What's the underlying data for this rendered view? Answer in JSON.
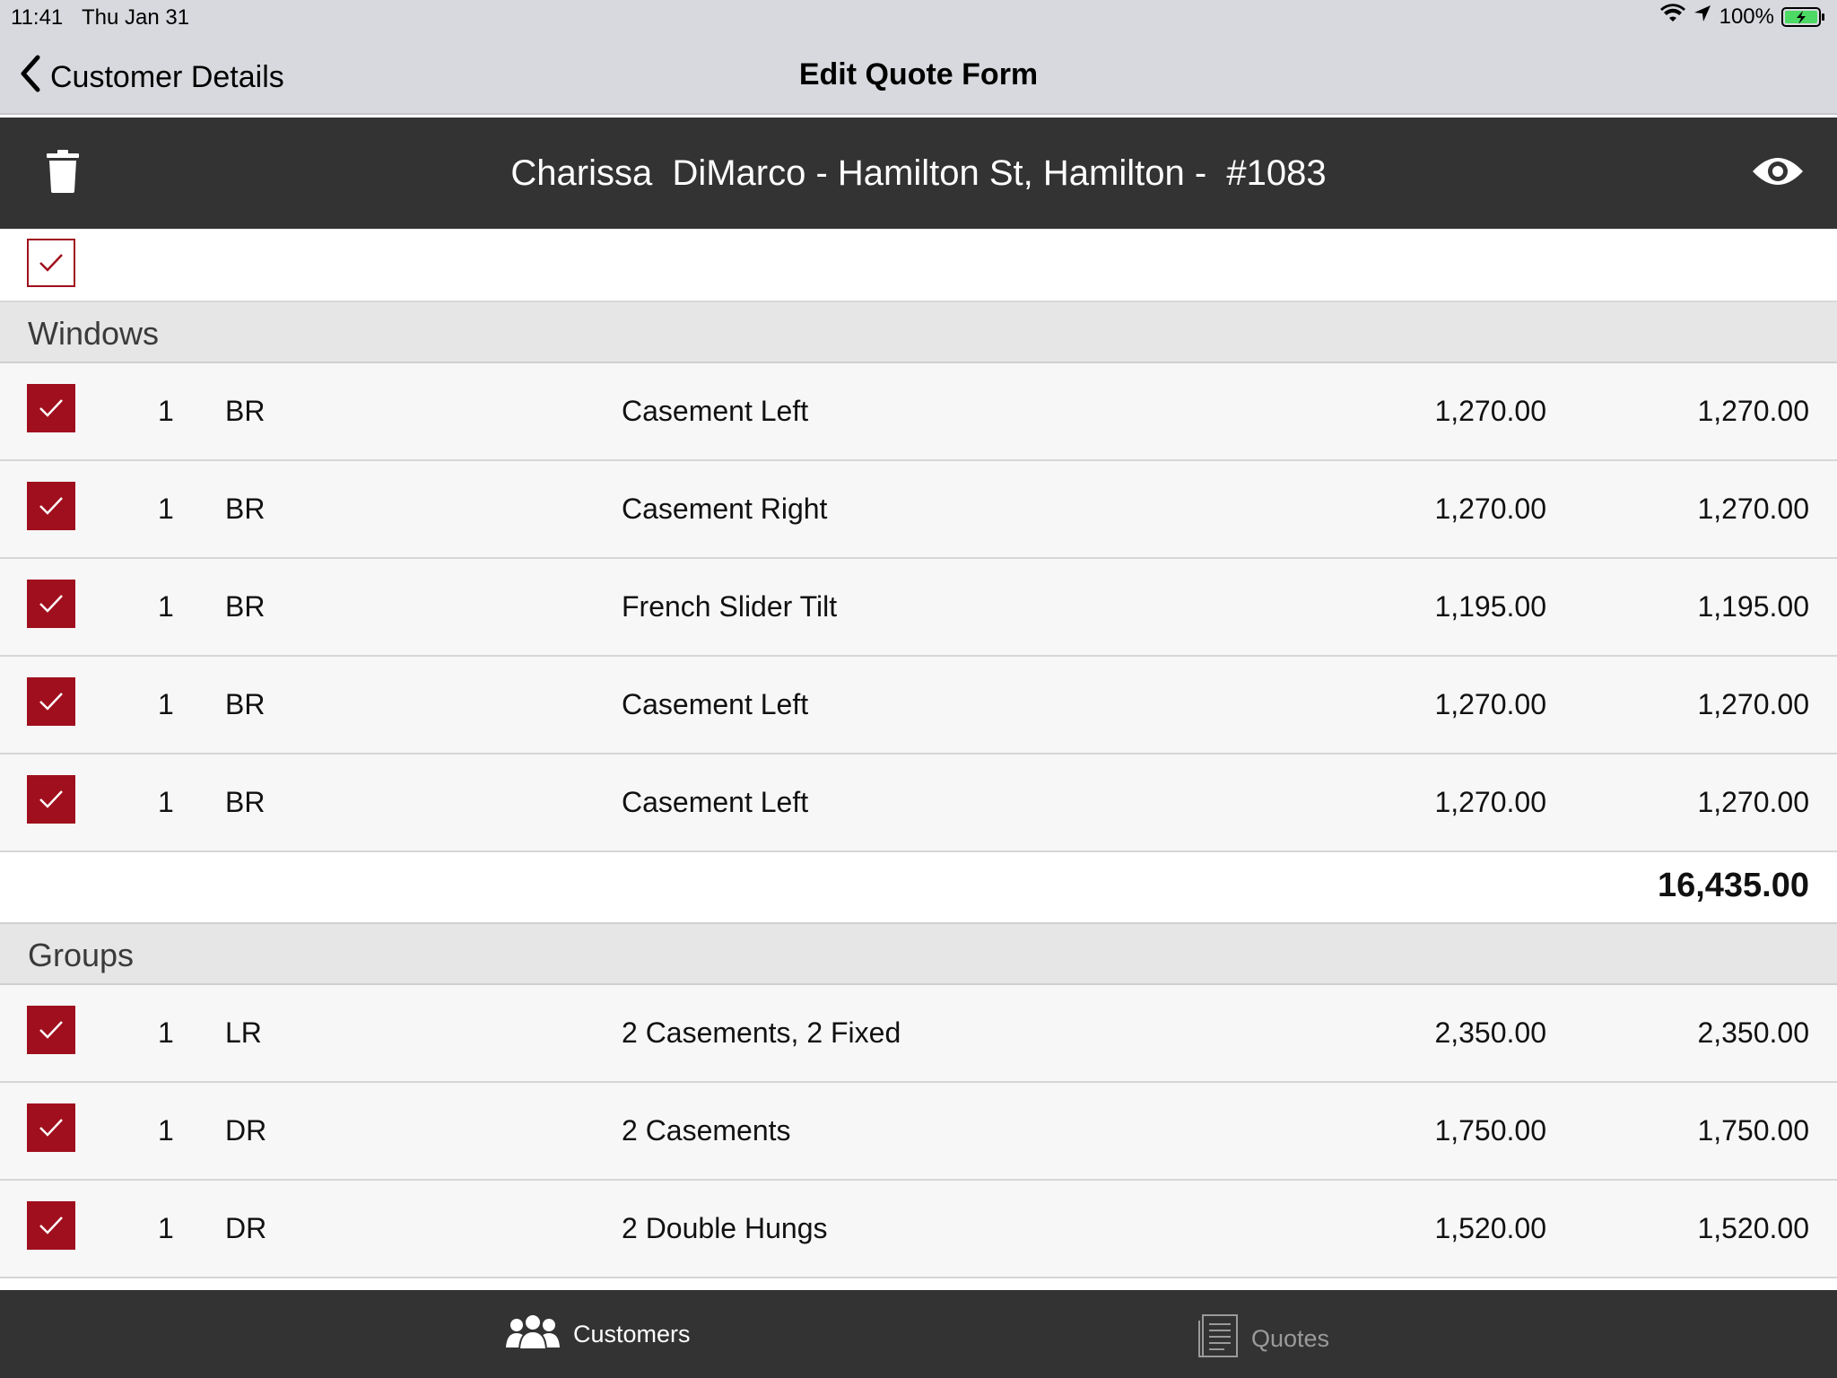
{
  "status_bar": {
    "time": "11:41",
    "date": "Thu Jan 31",
    "battery": "100%"
  },
  "nav": {
    "back_label": "Customer Details",
    "title": "Edit Quote Form"
  },
  "header": {
    "title": "Charissa  DiMarco - Hamilton St, Hamilton -  #1083"
  },
  "sections": {
    "windows": {
      "label": "Windows",
      "items": [
        {
          "checked": true,
          "qty": "1",
          "room": "BR",
          "description": "Casement Left",
          "price": "1,270.00",
          "total": "1,270.00"
        },
        {
          "checked": true,
          "qty": "1",
          "room": "BR",
          "description": "Casement Right",
          "price": "1,270.00",
          "total": "1,270.00"
        },
        {
          "checked": true,
          "qty": "1",
          "room": "BR",
          "description": "French Slider Tilt",
          "price": "1,195.00",
          "total": "1,195.00"
        },
        {
          "checked": true,
          "qty": "1",
          "room": "BR",
          "description": "Casement Left",
          "price": "1,270.00",
          "total": "1,270.00"
        },
        {
          "checked": true,
          "qty": "1",
          "room": "BR",
          "description": "Casement Left",
          "price": "1,270.00",
          "total": "1,270.00"
        }
      ],
      "subtotal": "16,435.00"
    },
    "groups": {
      "label": "Groups",
      "items": [
        {
          "checked": true,
          "qty": "1",
          "room": "LR",
          "description": "2 Casements, 2 Fixed",
          "price": "2,350.00",
          "total": "2,350.00"
        },
        {
          "checked": true,
          "qty": "1",
          "room": "DR",
          "description": "2 Casements",
          "price": "1,750.00",
          "total": "1,750.00"
        },
        {
          "checked": true,
          "qty": "1",
          "room": "DR",
          "description": "2 Double Hungs",
          "price": "1,520.00",
          "total": "1,520.00"
        }
      ]
    }
  },
  "tabs": {
    "customers": "Customers",
    "quotes": "Quotes"
  },
  "icons": {
    "back": "chevron-left-icon",
    "trash": "trash-icon",
    "eye": "eye-icon",
    "wifi": "wifi-icon",
    "location": "location-arrow-icon",
    "battery": "battery-charging-icon",
    "customers": "people-icon",
    "quotes": "document-icon",
    "check": "checkmark-icon"
  },
  "colors": {
    "accent": "#a00f1d",
    "header_bg": "#333333",
    "nav_bg": "#d7d9de",
    "section_bg": "#e6e6e6",
    "row_bg": "#f7f7f7",
    "battery_green": "#4cd964"
  }
}
